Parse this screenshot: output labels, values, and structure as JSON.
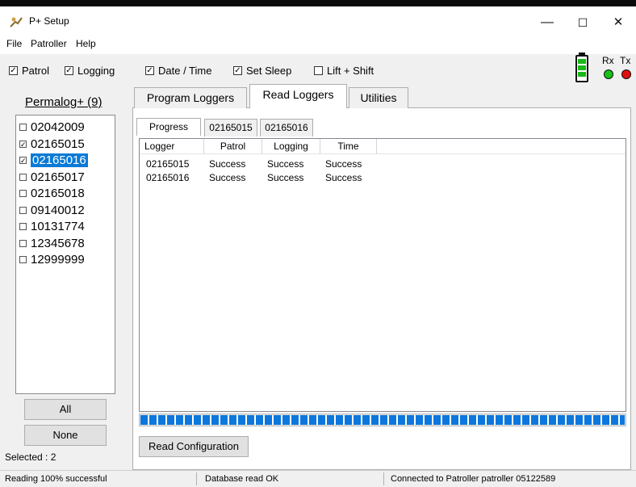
{
  "window": {
    "title": "P+ Setup",
    "minimize": "—",
    "maximize": "☐",
    "close": "✕"
  },
  "menu": [
    "File",
    "Patroller",
    "Help"
  ],
  "toolbar": {
    "checkboxes": [
      {
        "label": "Patrol",
        "checked": true
      },
      {
        "label": "Logging",
        "checked": true
      },
      {
        "label": "Date / Time",
        "checked": true
      },
      {
        "label": "Set Sleep",
        "checked": true
      },
      {
        "label": "Lift + Shift",
        "checked": false
      }
    ],
    "rx_label": "Rx",
    "tx_label": "Tx",
    "rx_color": "#18c018",
    "tx_color": "#e01010",
    "battery_level": 1.0
  },
  "sidebar": {
    "title": "Permalog+ (9)",
    "loggers": [
      {
        "id": "02042009",
        "checked": false,
        "selected": false
      },
      {
        "id": "02165015",
        "checked": true,
        "selected": false
      },
      {
        "id": "02165016",
        "checked": true,
        "selected": true
      },
      {
        "id": "02165017",
        "checked": false,
        "selected": false
      },
      {
        "id": "02165018",
        "checked": false,
        "selected": false
      },
      {
        "id": "09140012",
        "checked": false,
        "selected": false
      },
      {
        "id": "10131774",
        "checked": false,
        "selected": false
      },
      {
        "id": "12345678",
        "checked": false,
        "selected": false
      },
      {
        "id": "12999999",
        "checked": false,
        "selected": false
      }
    ],
    "all_button": "All",
    "none_button": "None",
    "selected_text": "Selected : 2"
  },
  "tabs": [
    "Program Loggers",
    "Read Loggers",
    "Utilities"
  ],
  "active_tab": "Read Loggers",
  "subtabs": [
    "Progress",
    "02165015",
    "02165016"
  ],
  "results": {
    "columns": [
      "Logger",
      "Patrol",
      "Logging",
      "Time"
    ],
    "rows": [
      [
        "02165015",
        "Success",
        "Success",
        "Success"
      ],
      [
        "02165016",
        "Success",
        "Success",
        "Success"
      ]
    ]
  },
  "progress": 1.0,
  "read_config_button": "Read Configuration",
  "status": {
    "left": "Reading 100% successful",
    "middle": "Database read OK",
    "right": "Connected to Patroller patroller 05122589"
  }
}
